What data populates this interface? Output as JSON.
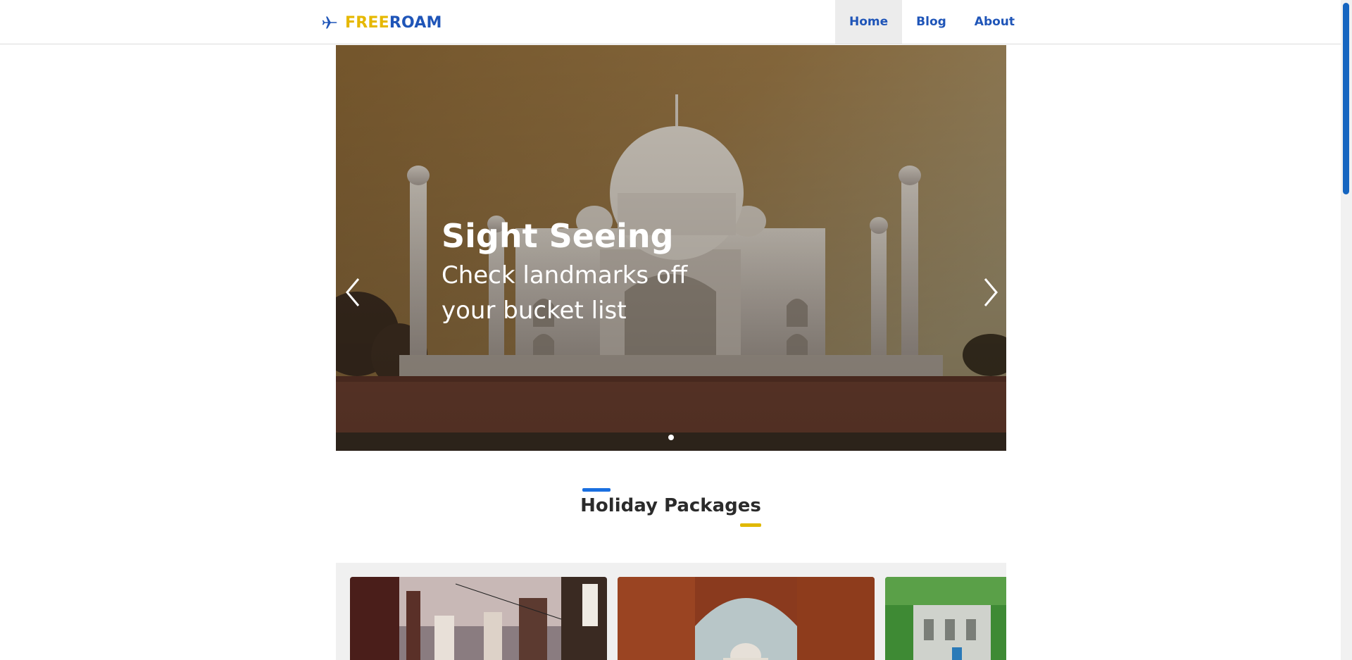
{
  "brand": {
    "part1": "FREE",
    "part2": "ROAM",
    "icon": "airplane-icon"
  },
  "nav": {
    "items": [
      {
        "label": "Home",
        "active": true
      },
      {
        "label": "Blog",
        "active": false
      },
      {
        "label": "About",
        "active": false
      }
    ]
  },
  "hero": {
    "title": "Sight Seeing",
    "subtitle": "Check landmarks off your bucket list",
    "prev_icon": "chevron-left-icon",
    "next_icon": "chevron-right-icon"
  },
  "section": {
    "title": "Holiday Packages"
  },
  "colors": {
    "brand_yellow": "#e6b800",
    "brand_blue": "#1f55b8",
    "accent_blue": "#1a6fe0",
    "accent_yellow": "#e0b800"
  }
}
